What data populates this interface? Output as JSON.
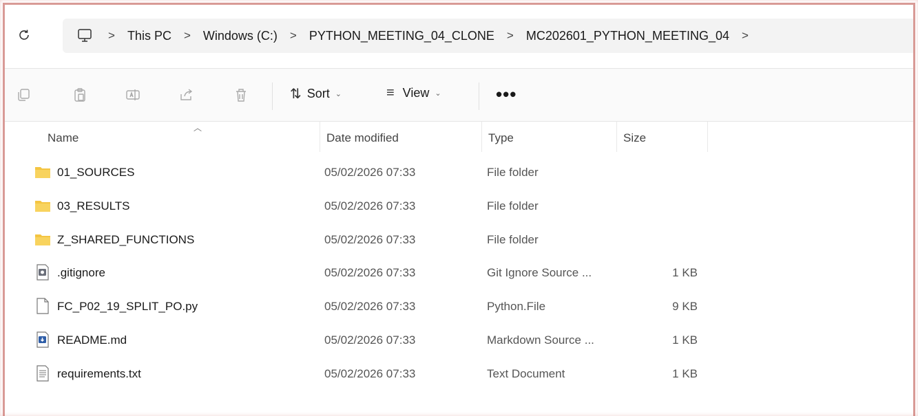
{
  "breadcrumb": {
    "root_icon": "computer-icon",
    "items": [
      "This PC",
      "Windows (C:)",
      "PYTHON_MEETING_04_CLONE",
      "MC202601_PYTHON_MEETING_04"
    ],
    "separator": ">"
  },
  "toolbar": {
    "icons": [
      "copy-icon",
      "paste-icon",
      "rename-icon",
      "share-icon",
      "delete-icon"
    ],
    "sort_label": "Sort",
    "view_label": "View",
    "more_label": "•••"
  },
  "columns": {
    "name": "Name",
    "date": "Date modified",
    "type": "Type",
    "size": "Size"
  },
  "files": [
    {
      "icon": "folder-icon",
      "name": "01_SOURCES",
      "date": "05/02/2026 07:33",
      "type": "File folder",
      "size": ""
    },
    {
      "icon": "folder-icon",
      "name": "03_RESULTS",
      "date": "05/02/2026 07:33",
      "type": "File folder",
      "size": ""
    },
    {
      "icon": "folder-icon",
      "name": "Z_SHARED_FUNCTIONS",
      "date": "05/02/2026 07:33",
      "type": "File folder",
      "size": ""
    },
    {
      "icon": "config-file-icon",
      "name": ".gitignore",
      "date": "05/02/2026 07:33",
      "type": "Git Ignore Source ...",
      "size": "1 KB"
    },
    {
      "icon": "blank-file-icon",
      "name": "FC_P02_19_SPLIT_PO.py",
      "date": "05/02/2026 07:33",
      "type": "Python.File",
      "size": "9 KB"
    },
    {
      "icon": "markdown-file-icon",
      "name": "README.md",
      "date": "05/02/2026 07:33",
      "type": "Markdown Source ...",
      "size": "1 KB"
    },
    {
      "icon": "text-file-icon",
      "name": "requirements.txt",
      "date": "05/02/2026 07:33",
      "type": "Text Document",
      "size": "1 KB"
    }
  ],
  "colors": {
    "folder": "#f4c542",
    "frame_border": "#d99b97",
    "breadcrumb_bg": "#f3f3f3"
  }
}
